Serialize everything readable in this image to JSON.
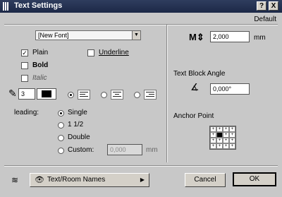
{
  "window": {
    "title": "Text Settings",
    "help_button": "?",
    "close_button": "X",
    "default_link": "Default"
  },
  "font": {
    "selected": "[New Font]"
  },
  "styles": {
    "plain": {
      "label": "Plain",
      "checked": true
    },
    "underline": {
      "label": "Underline",
      "checked": false
    },
    "bold": {
      "label": "Bold",
      "checked": false
    },
    "italic": {
      "label": "Italic",
      "checked": false
    }
  },
  "pen": {
    "value": "3"
  },
  "leading": {
    "label": "leading:",
    "options": [
      "Single",
      "1 1/2",
      "Double",
      "Custom:"
    ],
    "selected": "Single",
    "custom_value": "0,000",
    "custom_unit": "mm"
  },
  "size": {
    "value": "2,000",
    "unit": "mm"
  },
  "angle": {
    "label": "Text Block Angle",
    "value": "0,000°"
  },
  "anchor": {
    "label": "Anchor Point"
  },
  "footer": {
    "layer": "Text/Room Names",
    "cancel": "Cancel",
    "ok": "OK"
  }
}
